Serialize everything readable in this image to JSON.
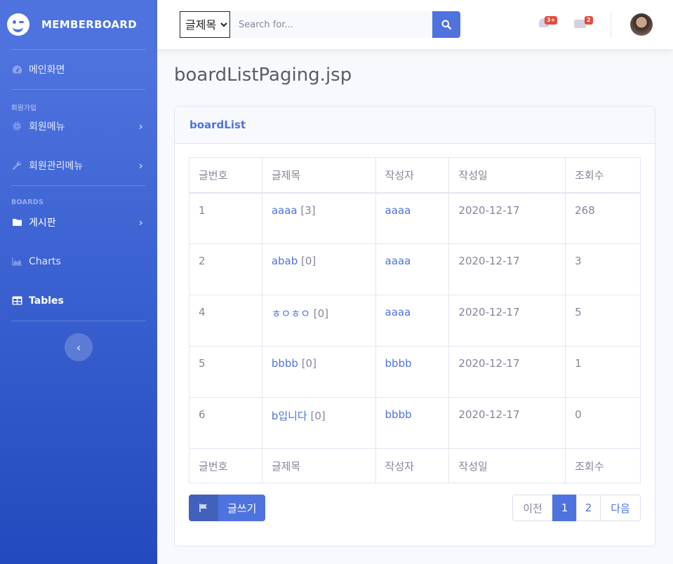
{
  "brand": {
    "name": "MEMBERBOARD",
    "logo_icon": "laugh-wink-icon"
  },
  "sidebar": {
    "dashboard": {
      "label": "메인화면",
      "icon": "tachometer-icon"
    },
    "heading_member": "회원가입",
    "member_menu": {
      "label": "회원메뉴",
      "icon": "gear-icon"
    },
    "admin_menu": {
      "label": "회원관리메뉴",
      "icon": "wrench-icon"
    },
    "heading_boards": "BOARDS",
    "board": {
      "label": "게시판",
      "icon": "folder-icon"
    },
    "charts": {
      "label": "Charts",
      "icon": "chart-area-icon"
    },
    "tables": {
      "label": "Tables",
      "icon": "table-icon"
    }
  },
  "topbar": {
    "search_select": "글제목",
    "search_placeholder": "Search for...",
    "alerts_badge": "3+",
    "messages_badge": "2"
  },
  "page": {
    "title": "boardListPaging.jsp"
  },
  "card": {
    "title": "boardList"
  },
  "table": {
    "headers": [
      "글번호",
      "글제목",
      "작성자",
      "작성일",
      "조회수"
    ],
    "rows": [
      {
        "no": "1",
        "title": "aaaa",
        "comments": "[3]",
        "writer": "aaaa",
        "date": "2020-12-17",
        "views": "268"
      },
      {
        "no": "2",
        "title": "abab",
        "comments": "[0]",
        "writer": "aaaa",
        "date": "2020-12-17",
        "views": "3"
      },
      {
        "no": "4",
        "title": "ㅎㅇㅎㅇ",
        "comments": "[0]",
        "writer": "aaaa",
        "date": "2020-12-17",
        "views": "5"
      },
      {
        "no": "5",
        "title": "bbbb",
        "comments": "[0]",
        "writer": "bbbb",
        "date": "2020-12-17",
        "views": "1"
      },
      {
        "no": "6",
        "title": "b입니다",
        "comments": "[0]",
        "writer": "bbbb",
        "date": "2020-12-17",
        "views": "0"
      }
    ]
  },
  "write_button": {
    "label": "글쓰기",
    "icon": "flag-icon"
  },
  "pagination": {
    "prev": "이전",
    "pages": [
      "1",
      "2"
    ],
    "current": "1",
    "next": "다음"
  },
  "colors": {
    "primary": "#4e73df",
    "sidebar_end": "#224abe",
    "badge": "#e74a3b",
    "text": "#858796"
  }
}
